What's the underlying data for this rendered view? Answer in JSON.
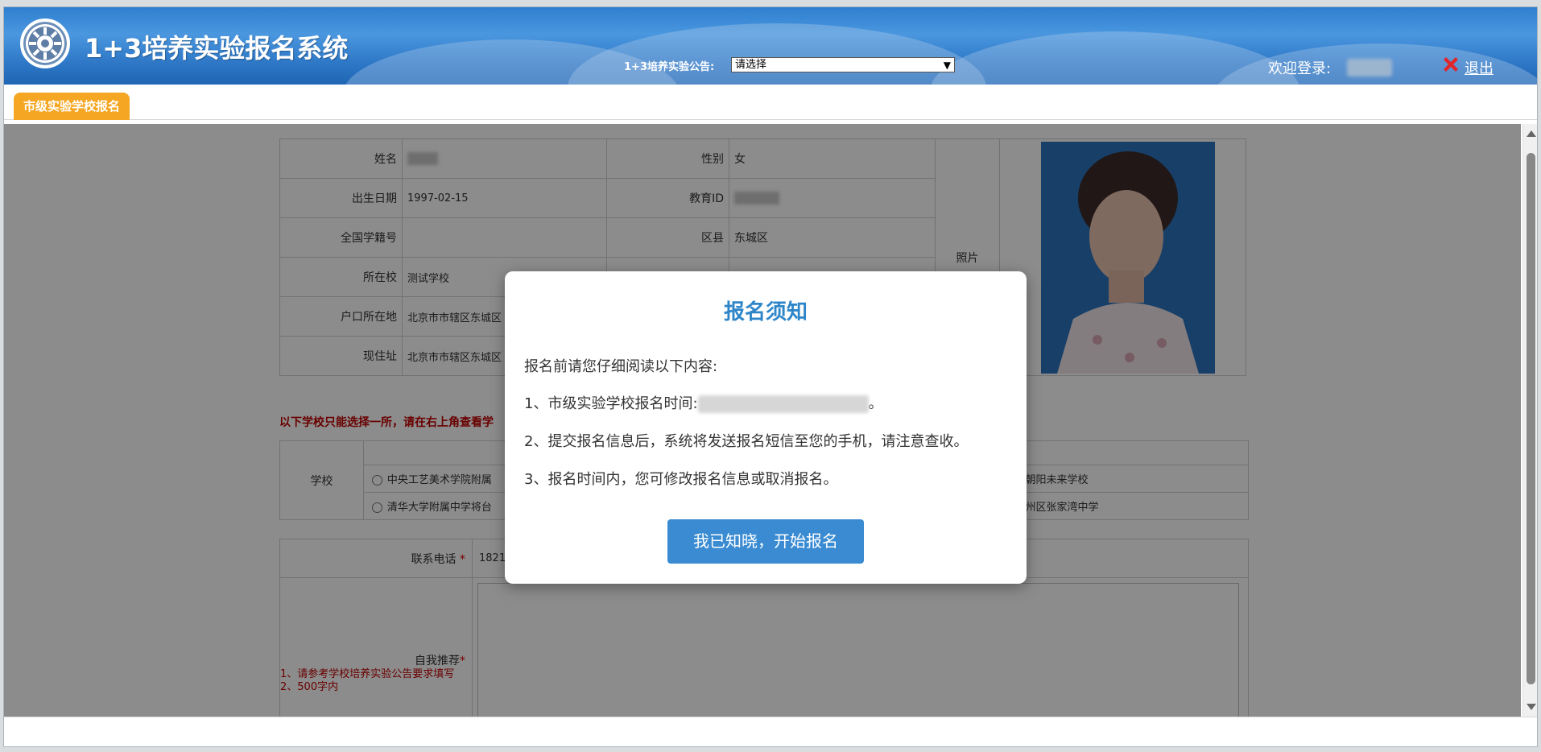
{
  "header": {
    "system_title": "1+3培养实验报名系统",
    "notice_label": "1+3培养实验公告:",
    "notice_select_value": "请选择",
    "welcome_label": "欢迎登录:",
    "logout_label": "退出"
  },
  "tabs": [
    {
      "label": "市级实验学校报名"
    }
  ],
  "student": {
    "name_label": "姓名",
    "gender_label": "性别",
    "gender": "女",
    "birth_label": "出生日期",
    "birth": "1997-02-15",
    "edu_id_label": "教育ID",
    "national_id_label": "全国学籍号",
    "district_label": "区县",
    "district": "东城区",
    "school_label": "所在校",
    "school": "测试学校",
    "hukou_label": "户口所在地",
    "hukou": "北京市市辖区东城区",
    "address_label": "现住址",
    "address": "北京市市辖区东城区",
    "photo_label": "照片"
  },
  "school_section": {
    "warning": "以下学校只能选择一所，请在右上角查看学",
    "school_label": "学校",
    "options_left": [
      "中央工艺美术学院附属",
      "清华大学附属中学将台"
    ],
    "options_right": [
      "朝阳未来学校",
      "州区张家湾中学"
    ]
  },
  "contact": {
    "phone_label": "联系电话",
    "phone_value": "1821",
    "self_rec_label": "自我推荐",
    "required_mark": "*",
    "note_1": "1、请参考学校培养实验公告要求填写",
    "note_2": "2、500字内"
  },
  "modal": {
    "title": "报名须知",
    "intro": "报名前请您仔细阅读以下内容:",
    "item_1_prefix": "1、市级实验学校报名时间:",
    "item_1_suffix": "。",
    "item_2": "2、提交报名信息后，系统将发送报名短信至您的手机，请注意查收。",
    "item_3": "3、报名时间内，您可修改报名信息或取消报名。",
    "button": "我已知晓，开始报名"
  },
  "colors": {
    "header_blue": "#2f7fd0",
    "tab_orange": "#f5a623",
    "modal_title_blue": "#2e86c9",
    "modal_button_blue": "#3a8bd2",
    "warning_red": "#c00000"
  }
}
